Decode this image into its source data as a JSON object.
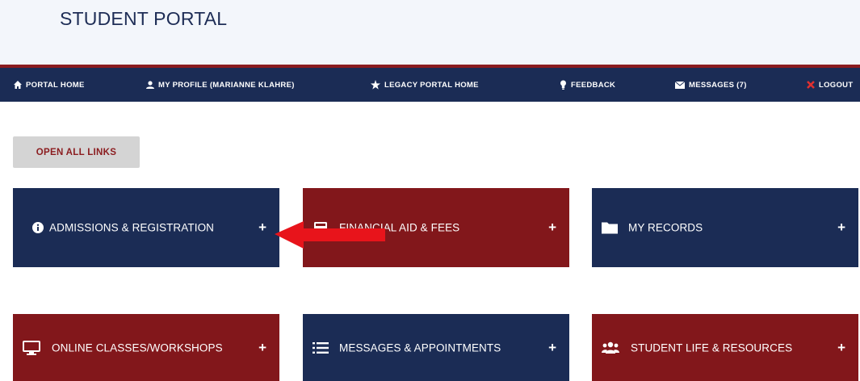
{
  "header": {
    "title": "STUDENT PORTAL"
  },
  "nav": {
    "items": [
      {
        "label": "PORTAL HOME",
        "icon": "home-icon"
      },
      {
        "label": "MY PROFILE (MARIANNE KLAHRE)",
        "icon": "user-icon"
      },
      {
        "label": "LEGACY PORTAL HOME",
        "icon": "star-icon"
      },
      {
        "label": "FEEDBACK",
        "icon": "lightbulb-icon"
      },
      {
        "label": "MESSAGES (7)",
        "icon": "envelope-icon"
      },
      {
        "label": "LOGOUT",
        "icon": "close-icon"
      }
    ]
  },
  "actions": {
    "open_all_label": "OPEN ALL LINKS"
  },
  "tiles": [
    {
      "label": "ADMISSIONS & REGISTRATION",
      "icon": "info-icon",
      "color": "#1b2c55",
      "expand": "+"
    },
    {
      "label": "FINANCIAL AID & FEES",
      "icon": "calculator-icon",
      "color": "#82171b",
      "expand": "+"
    },
    {
      "label": "MY RECORDS",
      "icon": "folder-icon",
      "color": "#1b2c55",
      "expand": "+"
    },
    {
      "label": "ONLINE CLASSES/WORKSHOPS",
      "icon": "monitor-icon",
      "color": "#82171b",
      "expand": "+"
    },
    {
      "label": "MESSAGES & APPOINTMENTS",
      "icon": "list-icon",
      "color": "#1b2c55",
      "expand": "+"
    },
    {
      "label": "STUDENT LIFE & RESOURCES",
      "icon": "users-icon",
      "color": "#82171b",
      "expand": "+"
    }
  ],
  "colors": {
    "navy": "#1b2c55",
    "maroon": "#82171b",
    "annotation_arrow": "#e8141b"
  }
}
